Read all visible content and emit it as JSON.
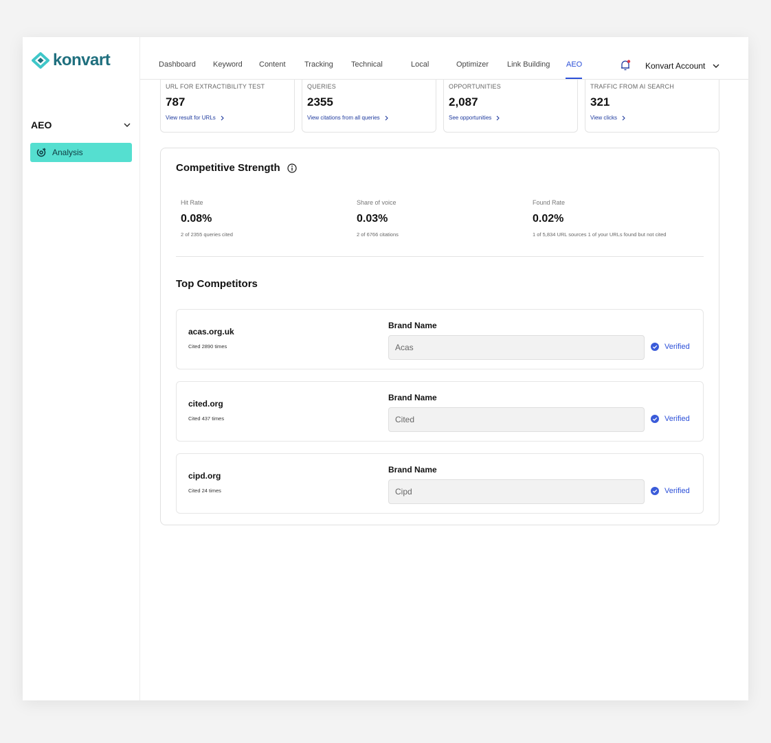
{
  "brand": {
    "name": "konvart",
    "color": "#1f6f7e",
    "accent": "#3fc7c9"
  },
  "sidebar": {
    "section": "AEO",
    "items": [
      {
        "label": "Analysis",
        "icon": "analysis-icon"
      }
    ]
  },
  "nav": {
    "tabs": [
      "Dashboard",
      "Keyword",
      "Content",
      "Tracking",
      "Technical",
      "Local",
      "Optimizer",
      "Link Building",
      "AEO"
    ],
    "active": "AEO",
    "account": "Konvart Account"
  },
  "metrics": [
    {
      "label": "URL FOR EXTRACTIBILITY TEST",
      "value": "787",
      "link": "View result for URLs"
    },
    {
      "label": "QUERIES",
      "value": "2355",
      "link": "View citations from all queries"
    },
    {
      "label": "OPPORTUNITIES",
      "value": "2,087",
      "link": "See opportunities"
    },
    {
      "label": "TRAFFIC FROM AI SEARCH",
      "value": "321",
      "link": "View clicks"
    }
  ],
  "competitive_strength": {
    "title": "Competitive Strength",
    "stats": [
      {
        "label": "Hit Rate",
        "value": "0.08%",
        "sub": "2 of 2355 queries cited"
      },
      {
        "label": "Share of voice",
        "value": "0.03%",
        "sub": "2 of 6766 citations"
      },
      {
        "label": "Found Rate",
        "value": "0.02%",
        "sub": "1 of 5,834 URL sources 1 of your URLs found but not cited"
      }
    ]
  },
  "top_competitors": {
    "title": "Top Competitors",
    "brand_label": "Brand Name",
    "verified_label": "Verified",
    "items": [
      {
        "domain": "acas.org.uk",
        "cited": "Cited 2890 times",
        "brand": "Acas"
      },
      {
        "domain": "cited.org",
        "cited": "Cited 437 times",
        "brand": "Cited"
      },
      {
        "domain": "cipd.org",
        "cited": "Cited 24 times",
        "brand": "Cipd"
      }
    ]
  },
  "colors": {
    "active_tab": "#2b4fd8",
    "sidebar_active": "#55dfd0",
    "notification_dot": "#e03a4a"
  }
}
